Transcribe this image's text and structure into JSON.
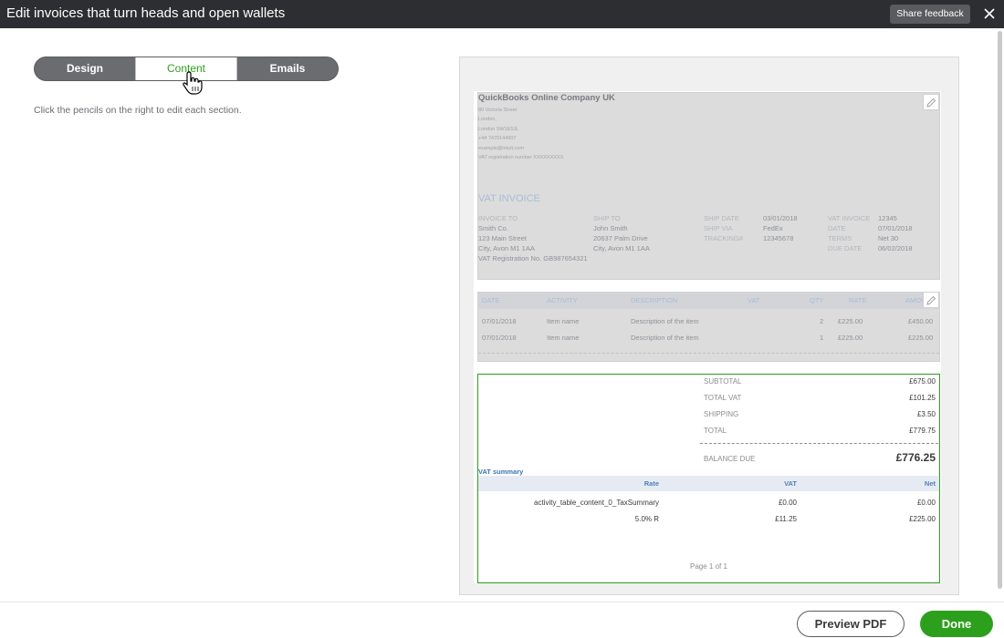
{
  "header": {
    "title": "Edit invoices that turn heads and open wallets",
    "feedback_label": "Share feedback",
    "close_icon": "close-icon"
  },
  "tabs": [
    {
      "label": "Design",
      "active": false
    },
    {
      "label": "Content",
      "active": true
    },
    {
      "label": "Emails",
      "active": false
    }
  ],
  "hint": "Click the pencils on the right to edit each section.",
  "invoice": {
    "company": {
      "name": "QuickBooks Online Company UK",
      "address": [
        "80 Victoria Street",
        "London,",
        "London SW1E5JL",
        "+44 7470144907",
        "example@intuit.com",
        "VAT registration number XXXXXXXXX"
      ]
    },
    "heading": "VAT INVOICE",
    "invoice_to_label": "INVOICE TO",
    "invoice_to": [
      "Smith Co.",
      "123 Main Street",
      "City, Avon M1 1AA",
      "VAT Registration No. GB987654321"
    ],
    "ship_to_label": "SHIP TO",
    "ship_to": [
      "John Smith",
      "20637 Palm Drive",
      "City, Avon M1 1AA"
    ],
    "ship_date_label": "SHIP DATE",
    "ship_date": "03/01/2018",
    "ship_via_label": "SHIP VIA",
    "ship_via": "FedEx",
    "tracking_label": "TRACKING#",
    "tracking": "12345678",
    "vat_invoice_label": "VAT INVOICE",
    "vat_invoice": "12345",
    "date_label": "DATE",
    "date": "07/01/2018",
    "terms_label": "TERMS",
    "terms": "Net 30",
    "due_date_label": "DUE DATE",
    "due_date": "06/02/2018",
    "table": {
      "headers": [
        "DATE",
        "ACTIVITY",
        "DESCRIPTION",
        "VAT",
        "QTY",
        "RATE",
        "AMOU"
      ],
      "rows": [
        {
          "date": "07/01/2018",
          "activity": "Item name",
          "description": "Description of the item",
          "qty": "2",
          "rate": "£225.00",
          "amount": "£450.00"
        },
        {
          "date": "07/01/2018",
          "activity": "Item name",
          "description": "Description of the item",
          "qty": "1",
          "rate": "£225.00",
          "amount": "£225.00"
        }
      ]
    },
    "totals": {
      "subtotal_label": "SUBTOTAL",
      "subtotal": "£675.00",
      "total_vat_label": "TOTAL VAT",
      "total_vat": "£101.25",
      "shipping_label": "SHIPPING",
      "shipping": "£3.50",
      "total_label": "TOTAL",
      "total": "£779.75",
      "balance_label": "BALANCE DUE",
      "balance": "£776.25"
    },
    "vat_summary": {
      "title": "VAT summary",
      "headers": [
        "Rate",
        "VAT",
        "Net"
      ],
      "rows": [
        {
          "rate": "activity_table_content_0_TaxSummary",
          "vat": "£0.00",
          "net": "£0.00"
        },
        {
          "rate": "5.0% R",
          "vat": "£11.25",
          "net": "£225.00"
        }
      ]
    },
    "page": "Page 1 of 1"
  },
  "footer": {
    "preview_label": "Preview PDF",
    "done_label": "Done"
  },
  "colors": {
    "accent": "#2ca01c",
    "header_bg": "#2d2e31"
  }
}
